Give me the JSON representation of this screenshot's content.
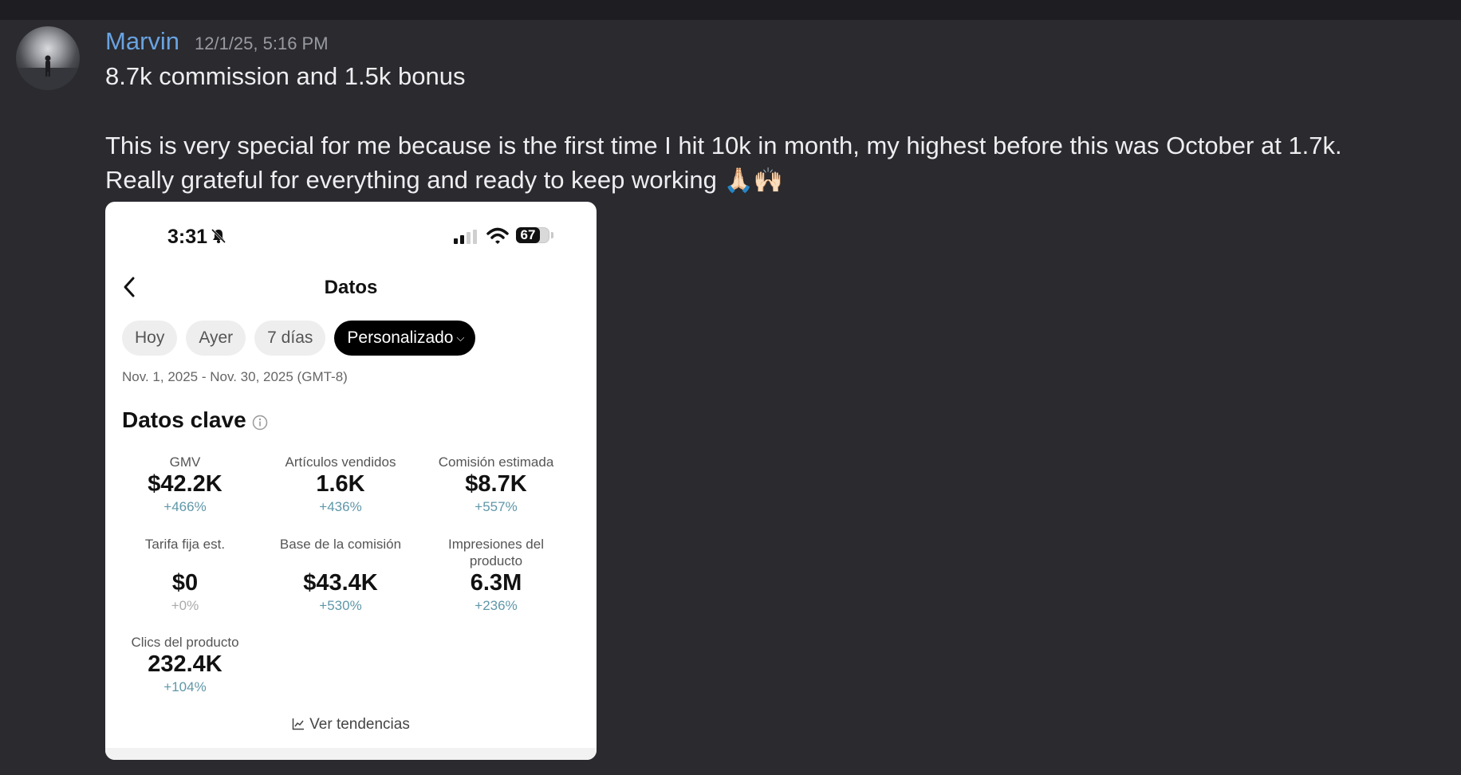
{
  "message": {
    "username": "Marvin",
    "timestamp": "12/1/25, 5:16 PM",
    "line1": "8.7k commission and 1.5k bonus",
    "line2": "This is very special for me because is the first time I hit 10k in month, my highest before this was October at 1.7k.",
    "line3": "Really grateful for everything and ready to keep working",
    "emojis": "🙏🏻🙌🏻"
  },
  "screenshot": {
    "status_time": "3:31",
    "battery": "67",
    "title": "Datos",
    "chips": [
      "Hoy",
      "Ayer",
      "7 días",
      "Personalizado"
    ],
    "date_range": "Nov. 1, 2025 - Nov. 30, 2025 (GMT-8)",
    "section_title": "Datos clave",
    "metrics": [
      {
        "label": "GMV",
        "value": "$42.2K",
        "change": "+466%"
      },
      {
        "label": "Artículos vendidos",
        "value": "1.6K",
        "change": "+436%"
      },
      {
        "label": "Comisión estimada",
        "value": "$8.7K",
        "change": "+557%"
      },
      {
        "label": "Tarifa fija est.",
        "value": "$0",
        "change": "+0%"
      },
      {
        "label": "Base de la comisión",
        "value": "$43.4K",
        "change": "+530%"
      },
      {
        "label": "Impresiones del producto",
        "value": "6.3M",
        "change": "+236%"
      },
      {
        "label": "Clics del producto",
        "value": "232.4K",
        "change": "+104%"
      }
    ],
    "trends_link": "Ver tendencias"
  }
}
